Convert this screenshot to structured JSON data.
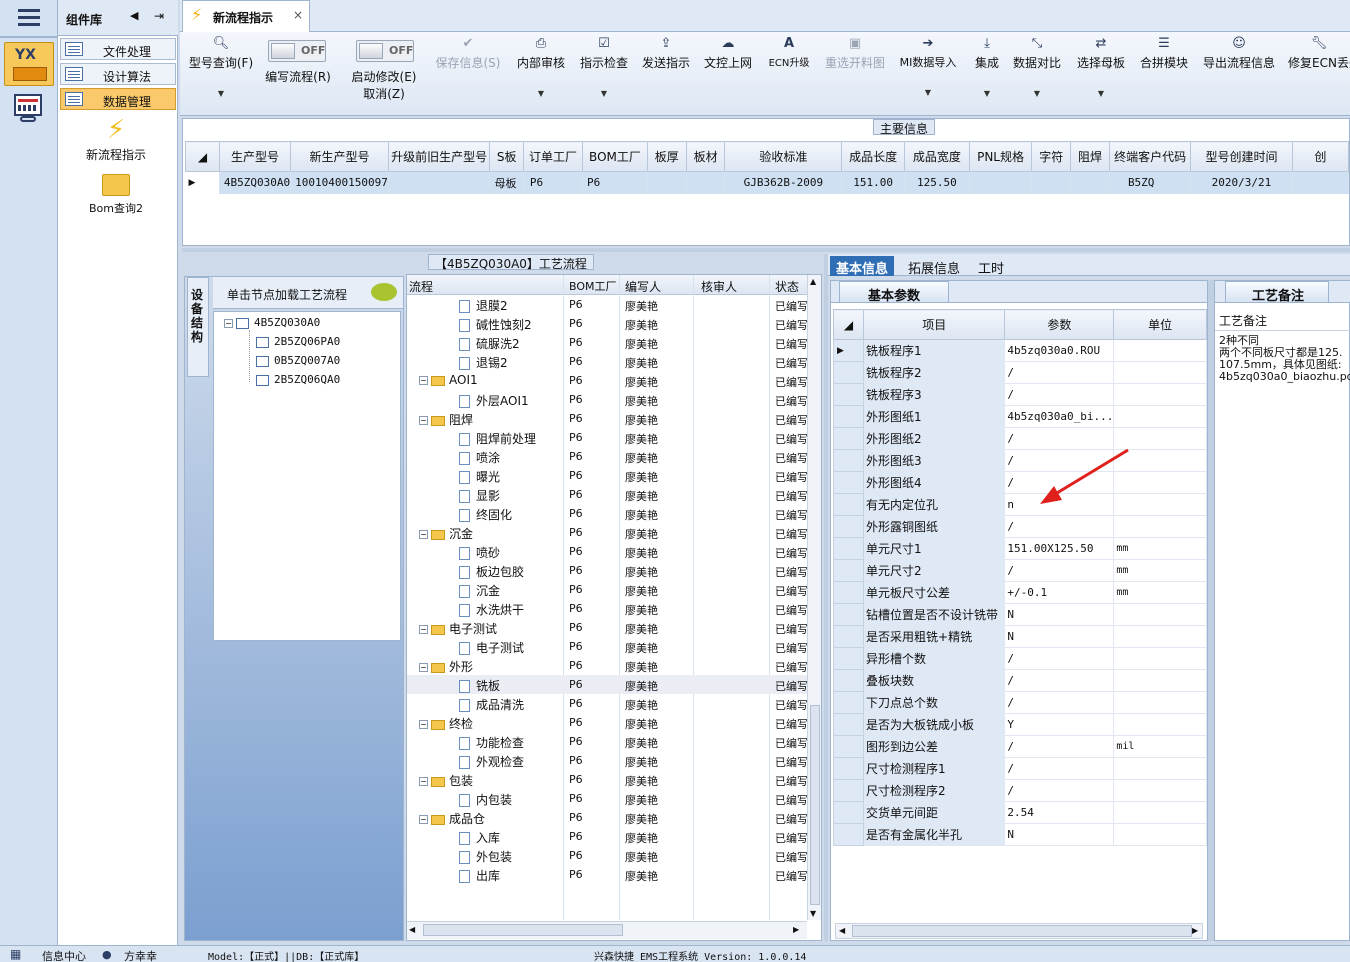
{
  "left_strip": {
    "app_icon_label": "YX"
  },
  "component_library": {
    "title": "组件库",
    "items": [
      {
        "label": "文件处理"
      },
      {
        "label": "设计算法"
      },
      {
        "label": "数据管理"
      }
    ],
    "tools": [
      {
        "label": "新流程指示",
        "icon": "lightning-icon"
      },
      {
        "label": "Bom查询2",
        "icon": "folder-open-icon"
      }
    ]
  },
  "doc_tab": {
    "title": "新流程指示",
    "close": "×"
  },
  "ribbon": {
    "toggle_off": "OFF",
    "buttons": [
      {
        "label": "型号查询(F)",
        "icon": "search-icon"
      },
      {
        "label": "编写流程(R)",
        "icon": "toggle-icon"
      },
      {
        "label": "启动修改(E)",
        "icon": "toggle-icon"
      },
      {
        "label": "取消(Z)"
      },
      {
        "label": "保存信息(S)",
        "icon": "check-icon"
      },
      {
        "label": "内部审核",
        "icon": "print-icon"
      },
      {
        "label": "指示检查",
        "icon": "checkbox-icon"
      },
      {
        "label": "发送指示",
        "icon": "upload-icon"
      },
      {
        "label": "文控上网",
        "icon": "cloud-upload-icon"
      },
      {
        "label": "ECN升级",
        "icon": "font-a-icon"
      },
      {
        "label": "重选开料图",
        "icon": "image-icon"
      },
      {
        "label": "MI数据导入",
        "icon": "import-icon"
      },
      {
        "label": "集成",
        "icon": "download-icon"
      },
      {
        "label": "数据对比",
        "icon": "compress-icon"
      },
      {
        "label": "选择母板",
        "icon": "shuffle-icon"
      },
      {
        "label": "合拼模块",
        "icon": "list-icon"
      },
      {
        "label": "导出流程信息",
        "icon": "smile-icon"
      },
      {
        "label": "修复ECN丢失",
        "icon": "wrench-icon"
      }
    ]
  },
  "main_info": {
    "title": "主要信息",
    "columns": [
      "生产型号",
      "新生产型号",
      "升级前旧生产型号",
      "S板",
      "订单工厂",
      "BOM工厂",
      "板厚",
      "板材",
      "验收标准",
      "成品长度",
      "成品宽度",
      "PNL规格",
      "字符",
      "阻焊",
      "终端客户代码",
      "型号创建时间",
      "创"
    ],
    "row": [
      "4B5ZQ030A0",
      "10010400150097",
      "",
      "母板",
      "P6",
      "P6",
      "",
      "",
      "GJB362B-2009",
      "151.00",
      "125.50",
      "",
      "",
      "",
      "B5ZQ",
      "2020/3/21",
      ""
    ]
  },
  "tree_panel": {
    "vertical_tab": "设备结构",
    "header": "单击节点加载工艺流程",
    "root": "4B5ZQ030A0",
    "children": [
      "2B5ZQ06PA0",
      "0B5ZQ007A0",
      "2B5ZQ06QA0"
    ]
  },
  "process_panel": {
    "title": "【4B5ZQ030A0】工艺流程",
    "columns": [
      "流程",
      "BOM工厂",
      "编写人",
      "核审人",
      "状态"
    ],
    "rows": [
      {
        "name": "退膜2",
        "type": "doc",
        "level": 2,
        "bom": "P6",
        "writer": "廖美艳",
        "status": "已编写"
      },
      {
        "name": "碱性蚀刻2",
        "type": "doc",
        "level": 2,
        "bom": "P6",
        "writer": "廖美艳",
        "status": "已编写"
      },
      {
        "name": "硫脲洗2",
        "type": "doc",
        "level": 2,
        "bom": "P6",
        "writer": "廖美艳",
        "status": "已编写"
      },
      {
        "name": "退锡2",
        "type": "doc",
        "level": 2,
        "bom": "P6",
        "writer": "廖美艳",
        "status": "已编写"
      },
      {
        "name": "AOI1",
        "type": "folder",
        "level": 1,
        "bom": "P6",
        "writer": "廖美艳",
        "status": "已编写"
      },
      {
        "name": "外层AOI1",
        "type": "doc",
        "level": 2,
        "bom": "P6",
        "writer": "廖美艳",
        "status": "已编写"
      },
      {
        "name": "阻焊",
        "type": "folder",
        "level": 1,
        "bom": "P6",
        "writer": "廖美艳",
        "status": "已编写"
      },
      {
        "name": "阻焊前处理",
        "type": "doc",
        "level": 2,
        "bom": "P6",
        "writer": "廖美艳",
        "status": "已编写"
      },
      {
        "name": "喷涂",
        "type": "doc",
        "level": 2,
        "bom": "P6",
        "writer": "廖美艳",
        "status": "已编写"
      },
      {
        "name": "曝光",
        "type": "doc",
        "level": 2,
        "bom": "P6",
        "writer": "廖美艳",
        "status": "已编写"
      },
      {
        "name": "显影",
        "type": "doc",
        "level": 2,
        "bom": "P6",
        "writer": "廖美艳",
        "status": "已编写"
      },
      {
        "name": "终固化",
        "type": "doc",
        "level": 2,
        "bom": "P6",
        "writer": "廖美艳",
        "status": "已编写"
      },
      {
        "name": "沉金",
        "type": "folder",
        "level": 1,
        "bom": "P6",
        "writer": "廖美艳",
        "status": "已编写"
      },
      {
        "name": "喷砂",
        "type": "doc",
        "level": 2,
        "bom": "P6",
        "writer": "廖美艳",
        "status": "已编写"
      },
      {
        "name": "板边包胶",
        "type": "doc",
        "level": 2,
        "bom": "P6",
        "writer": "廖美艳",
        "status": "已编写"
      },
      {
        "name": "沉金",
        "type": "doc",
        "level": 2,
        "bom": "P6",
        "writer": "廖美艳",
        "status": "已编写"
      },
      {
        "name": "水洗烘干",
        "type": "doc",
        "level": 2,
        "bom": "P6",
        "writer": "廖美艳",
        "status": "已编写"
      },
      {
        "name": "电子测试",
        "type": "folder",
        "level": 1,
        "bom": "P6",
        "writer": "廖美艳",
        "status": "已编写"
      },
      {
        "name": "电子测试",
        "type": "doc",
        "level": 2,
        "bom": "P6",
        "writer": "廖美艳",
        "status": "已编写"
      },
      {
        "name": "外形",
        "type": "folder",
        "level": 1,
        "bom": "P6",
        "writer": "廖美艳",
        "status": "已编写"
      },
      {
        "name": "铣板",
        "type": "doc",
        "level": 2,
        "bom": "P6",
        "writer": "廖美艳",
        "status": "已编写",
        "selected": true
      },
      {
        "name": "成品清洗",
        "type": "doc",
        "level": 2,
        "bom": "P6",
        "writer": "廖美艳",
        "status": "已编写"
      },
      {
        "name": "终检",
        "type": "folder",
        "level": 1,
        "bom": "P6",
        "writer": "廖美艳",
        "status": "已编写"
      },
      {
        "name": "功能检查",
        "type": "doc",
        "level": 2,
        "bom": "P6",
        "writer": "廖美艳",
        "status": "已编写"
      },
      {
        "name": "外观检查",
        "type": "doc",
        "level": 2,
        "bom": "P6",
        "writer": "廖美艳",
        "status": "已编写"
      },
      {
        "name": "包装",
        "type": "folder",
        "level": 1,
        "bom": "P6",
        "writer": "廖美艳",
        "status": "已编写"
      },
      {
        "name": "内包装",
        "type": "doc",
        "level": 2,
        "bom": "P6",
        "writer": "廖美艳",
        "status": "已编写"
      },
      {
        "name": "成品仓",
        "type": "folder",
        "level": 1,
        "bom": "P6",
        "writer": "廖美艳",
        "status": "已编写"
      },
      {
        "name": "入库",
        "type": "doc",
        "level": 2,
        "bom": "P6",
        "writer": "廖美艳",
        "status": "已编写"
      },
      {
        "name": "外包装",
        "type": "doc",
        "level": 2,
        "bom": "P6",
        "writer": "廖美艳",
        "status": "已编写"
      },
      {
        "name": "出库",
        "type": "doc",
        "level": 2,
        "bom": "P6",
        "writer": "廖美艳",
        "status": "已编写"
      }
    ]
  },
  "right_tabs": [
    "基本信息",
    "拓展信息",
    "工时"
  ],
  "basic_params": {
    "title": "基本参数",
    "columns": [
      "项目",
      "参数",
      "单位"
    ],
    "rows": [
      {
        "item": "铣板程序1",
        "value": "4b5zq030a0.ROU",
        "unit": ""
      },
      {
        "item": "铣板程序2",
        "value": "/",
        "unit": ""
      },
      {
        "item": "铣板程序3",
        "value": "/",
        "unit": ""
      },
      {
        "item": "外形图纸1",
        "value": "4b5zq030a0_bi...",
        "unit": ""
      },
      {
        "item": "外形图纸2",
        "value": "/",
        "unit": ""
      },
      {
        "item": "外形图纸3",
        "value": "/",
        "unit": ""
      },
      {
        "item": "外形图纸4",
        "value": "/",
        "unit": ""
      },
      {
        "item": "有无内定位孔",
        "value": "n",
        "unit": ""
      },
      {
        "item": "外形露铜图纸",
        "value": "/",
        "unit": ""
      },
      {
        "item": "单元尺寸1",
        "value": "151.00X125.50",
        "unit": "mm"
      },
      {
        "item": "单元尺寸2",
        "value": "/",
        "unit": "mm"
      },
      {
        "item": "单元板尺寸公差",
        "value": "+/-0.1",
        "unit": "mm"
      },
      {
        "item": "钻槽位置是否不设计铣带",
        "value": "N",
        "unit": ""
      },
      {
        "item": "是否采用粗铣+精铣",
        "value": "N",
        "unit": ""
      },
      {
        "item": "异形槽个数",
        "value": "/",
        "unit": ""
      },
      {
        "item": "叠板块数",
        "value": "/",
        "unit": ""
      },
      {
        "item": "下刀点总个数",
        "value": "/",
        "unit": ""
      },
      {
        "item": "是否为大板铣成小板",
        "value": "Y",
        "unit": ""
      },
      {
        "item": "图形到边公差",
        "value": "/",
        "unit": "mil"
      },
      {
        "item": "尺寸检测程序1",
        "value": "/",
        "unit": ""
      },
      {
        "item": "尺寸检测程序2",
        "value": "/",
        "unit": ""
      },
      {
        "item": "交货单元间距",
        "value": "2.54",
        "unit": ""
      },
      {
        "item": "是否有金属化半孔",
        "value": "N",
        "unit": ""
      }
    ]
  },
  "note_panel": {
    "title": "工艺备注",
    "subheader": "工艺备注",
    "text": "2种不同\n两个不同板尺寸都是125.\n107.5mm，具体见图纸:\n4b5zq030a0_biaozhu.pdf"
  },
  "status_bar": {
    "info_center": "信息中心",
    "user": "方幸幸",
    "model": "Model:【正式】||DB:【正式库】",
    "system": "兴森快捷 EMS工程系统 Version: 1.0.0.14"
  },
  "colors": {
    "accent": "#2f6db5",
    "selected_lib": "#f9c96c",
    "annotation_arrow": "#e0201c"
  }
}
